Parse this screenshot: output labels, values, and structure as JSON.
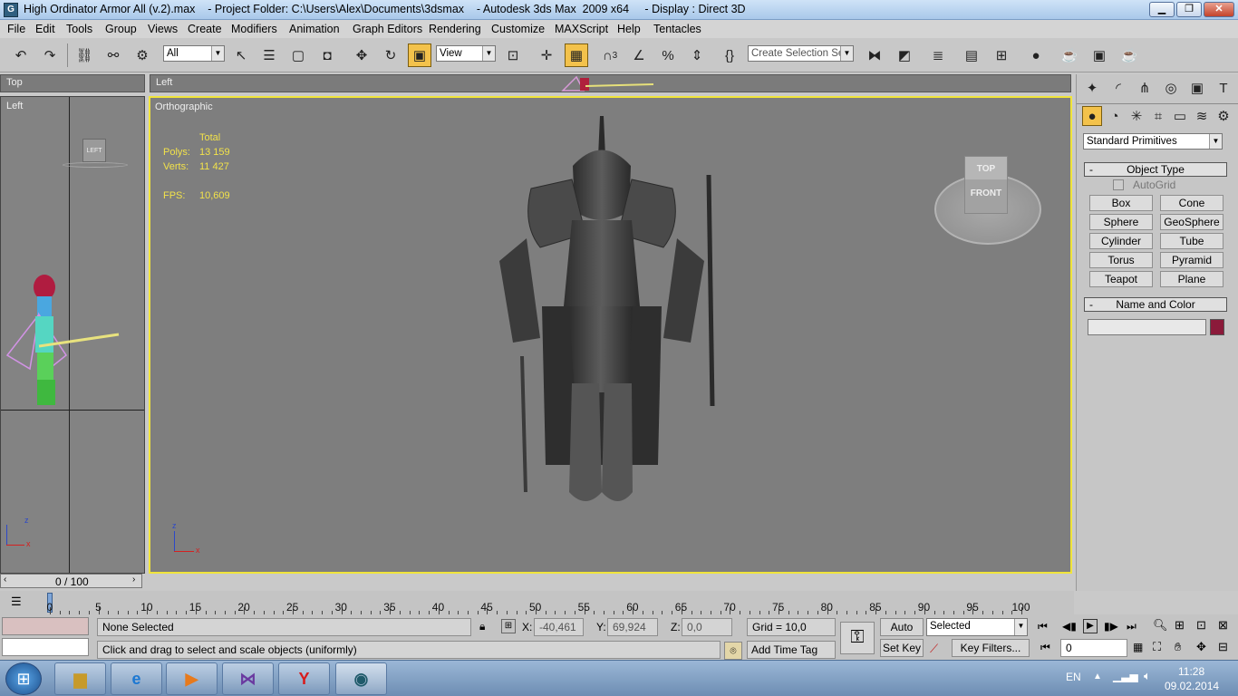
{
  "window": {
    "title": "High Ordinator Armor All (v.2).max    - Project Folder: C:\\Users\\Alex\\Documents\\3dsmax    - Autodesk 3ds Max  2009 x64     - Display : Direct 3D",
    "app_icon_text": "G"
  },
  "menu": [
    "File",
    "Edit",
    "Tools",
    "Group",
    "Views",
    "Create",
    "Modifiers",
    "Animation",
    "Graph Editors",
    "Rendering",
    "Customize",
    "MAXScript",
    "Help",
    "Tentacles"
  ],
  "toolbar": {
    "selection_filter": "All",
    "reference_coord": "View",
    "named_selection_placeholder": "Create Selection Set",
    "snap_label": "3"
  },
  "viewports": {
    "top_label": "Top",
    "topstrip_label": "Left",
    "small_label": "Left",
    "main_label": "Orthographic",
    "viewcube_small": "LEFT",
    "viewcube_top": "TOP",
    "viewcube_front": "FRONT",
    "axis_z": "z",
    "axis_x": "x",
    "stats": {
      "header": "Total",
      "polys_label": "Polys:",
      "polys_value": "13 159",
      "verts_label": "Verts:",
      "verts_value": "11 427",
      "fps_label": "FPS:",
      "fps_value": "10,609"
    }
  },
  "time_slider": {
    "label": "0 / 100",
    "ticks": [
      "0",
      "5",
      "10",
      "15",
      "20",
      "25",
      "30",
      "35",
      "40",
      "45",
      "50",
      "55",
      "60",
      "65",
      "70",
      "75",
      "80",
      "85",
      "90",
      "95",
      "100"
    ]
  },
  "command_panel": {
    "category": "Standard Primitives",
    "object_type_header": "Object Type",
    "autogrid": "AutoGrid",
    "primitives": [
      "Box",
      "Cone",
      "Sphere",
      "GeoSphere",
      "Cylinder",
      "Tube",
      "Torus",
      "Pyramid",
      "Teapot",
      "Plane"
    ],
    "name_color_header": "Name and Color",
    "name_value": "",
    "color": "#8b1a3a"
  },
  "status": {
    "selection": "None Selected",
    "prompt": "Click and drag to select and scale objects (uniformly)",
    "x_label": "X:",
    "x_value": "-40,461",
    "y_label": "Y:",
    "y_value": "69,924",
    "z_label": "Z:",
    "z_value": "0,0",
    "grid": "Grid = 10,0",
    "add_time_tag": "Add Time Tag",
    "auto_key": "Auto Key",
    "set_key": "Set Key",
    "key_mode": "Selected",
    "key_filters": "Key Filters...",
    "frame": "0"
  },
  "taskbar": {
    "lang": "EN",
    "time": "11:28",
    "date": "09.02.2014"
  }
}
